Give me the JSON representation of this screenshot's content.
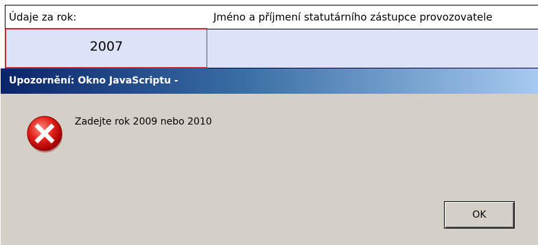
{
  "form": {
    "year_header": "Údaje za rok:",
    "name_header": "Jméno a příjmení statutárního zástupce provozovatele",
    "year_value": "2007",
    "name_value": ""
  },
  "dialog": {
    "title": "Upozornění: Okno JavaScriptu -",
    "icon": "error-icon",
    "message": "Zadejte rok 2009 nebo 2010",
    "ok_label": "OK"
  },
  "colors": {
    "input_fill": "#dce3f8",
    "error_border": "#c6282b",
    "titlebar_start": "#0a246a",
    "titlebar_end": "#a6caf0",
    "dialog_face": "#d4d0c8"
  }
}
